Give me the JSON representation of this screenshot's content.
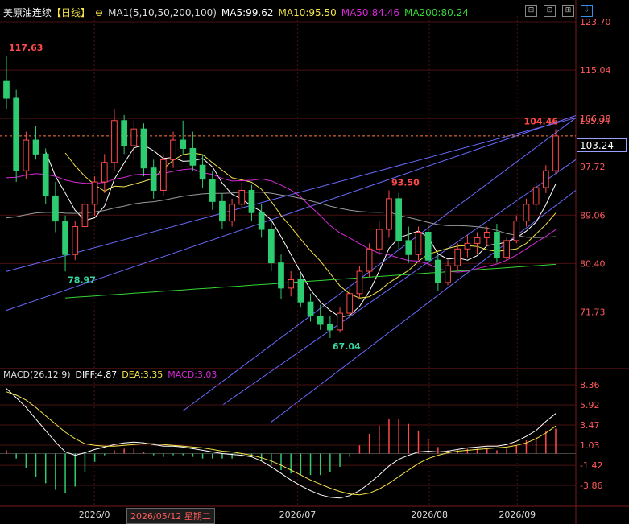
{
  "header": {
    "name": "美原油连续",
    "period": "【日线】",
    "icon": "settings-icon",
    "ma_group_label": "MA1(5,10,50,200,100)",
    "ma5": "MA5:99.62",
    "ma10": "MA10:95.50",
    "ma50": "MA50:84.46",
    "ma200": "MA200:80.24"
  },
  "macd_header": {
    "label": "MACD(26,12,9)",
    "diff": "DIFF:4.87",
    "dea": "DEA:3.35",
    "macd": "MACD:3.03"
  },
  "toolbar": {
    "buttons": [
      "⊟",
      "⊡",
      "⊞",
      "⇩"
    ]
  },
  "current_price": "103.24",
  "date_tip": "2026/05/12 星期二",
  "colors": {
    "up": "#ff4a4a",
    "down": "#2ecc71",
    "ma5": "#ffffff",
    "ma10": "#f5e44a",
    "ma50": "#d62ad6",
    "ma200": "#36d636",
    "ma100": "#9b9b9b",
    "trendline": "#6a6aff",
    "grid": "#4a1010",
    "dif": "#ffffff",
    "dea": "#f5e44a"
  },
  "chart_data": [
    {
      "type": "candlestick",
      "title": "美原油连续",
      "x_ticks": [
        "2026/0",
        "2026/07",
        "2026/08",
        "2026/09"
      ],
      "y_ticks": [
        "123.70",
        "115.04",
        "106.38",
        "97.72",
        "89.06",
        "80.40",
        "71.73"
      ],
      "ylim": [
        67.04,
        123.7
      ],
      "annotations": [
        {
          "label": "117.63",
          "value": 117.63,
          "kind": "high"
        },
        {
          "label": "78.97",
          "value": 78.97,
          "kind": "low"
        },
        {
          "label": "93.50",
          "value": 93.5,
          "kind": "high"
        },
        {
          "label": "67.04",
          "value": 67.04,
          "kind": "low"
        },
        {
          "label": "104.46",
          "value": 104.46,
          "kind": "high"
        }
      ],
      "price_line": 103.24,
      "right_labels": [
        "105.94"
      ],
      "series": [
        {
          "name": "MA5",
          "value": 99.62
        },
        {
          "name": "MA10",
          "value": 95.5
        },
        {
          "name": "MA50",
          "value": 84.46
        },
        {
          "name": "MA200",
          "value": 80.24
        }
      ],
      "candles": [
        {
          "o": 113.0,
          "h": 117.63,
          "l": 108.0,
          "c": 110.0
        },
        {
          "o": 110.0,
          "h": 111.5,
          "l": 95.0,
          "c": 97.0
        },
        {
          "o": 97.0,
          "h": 104.0,
          "l": 95.5,
          "c": 102.5
        },
        {
          "o": 102.5,
          "h": 105.0,
          "l": 99.0,
          "c": 100.0
        },
        {
          "o": 100.0,
          "h": 101.0,
          "l": 91.0,
          "c": 92.5
        },
        {
          "o": 92.5,
          "h": 95.0,
          "l": 86.0,
          "c": 88.0
        },
        {
          "o": 88.0,
          "h": 89.0,
          "l": 78.97,
          "c": 82.0
        },
        {
          "o": 82.0,
          "h": 88.0,
          "l": 81.0,
          "c": 87.0
        },
        {
          "o": 87.0,
          "h": 92.0,
          "l": 86.0,
          "c": 91.0
        },
        {
          "o": 91.0,
          "h": 96.0,
          "l": 89.0,
          "c": 95.0
        },
        {
          "o": 95.0,
          "h": 100.0,
          "l": 93.0,
          "c": 98.5
        },
        {
          "o": 98.5,
          "h": 108.0,
          "l": 97.0,
          "c": 106.0
        },
        {
          "o": 106.0,
          "h": 107.0,
          "l": 100.0,
          "c": 101.5
        },
        {
          "o": 101.5,
          "h": 106.0,
          "l": 99.0,
          "c": 104.5
        },
        {
          "o": 104.5,
          "h": 105.5,
          "l": 96.0,
          "c": 97.5
        },
        {
          "o": 97.5,
          "h": 99.0,
          "l": 92.0,
          "c": 93.5
        },
        {
          "o": 93.5,
          "h": 100.0,
          "l": 92.5,
          "c": 99.0
        },
        {
          "o": 99.0,
          "h": 104.0,
          "l": 97.5,
          "c": 102.5
        },
        {
          "o": 102.5,
          "h": 106.0,
          "l": 100.0,
          "c": 101.0
        },
        {
          "o": 101.0,
          "h": 104.0,
          "l": 97.0,
          "c": 98.0
        },
        {
          "o": 98.0,
          "h": 100.0,
          "l": 94.0,
          "c": 95.5
        },
        {
          "o": 95.5,
          "h": 97.0,
          "l": 90.0,
          "c": 91.5
        },
        {
          "o": 91.5,
          "h": 93.0,
          "l": 86.5,
          "c": 88.0
        },
        {
          "o": 88.0,
          "h": 92.0,
          "l": 87.0,
          "c": 91.0
        },
        {
          "o": 91.0,
          "h": 95.0,
          "l": 90.0,
          "c": 93.5
        },
        {
          "o": 93.5,
          "h": 94.5,
          "l": 88.0,
          "c": 89.5
        },
        {
          "o": 89.5,
          "h": 91.0,
          "l": 85.0,
          "c": 86.5
        },
        {
          "o": 86.5,
          "h": 88.0,
          "l": 79.0,
          "c": 80.5
        },
        {
          "o": 80.5,
          "h": 82.0,
          "l": 74.0,
          "c": 76.0
        },
        {
          "o": 76.0,
          "h": 79.0,
          "l": 74.5,
          "c": 77.5
        },
        {
          "o": 77.5,
          "h": 78.5,
          "l": 72.5,
          "c": 73.5
        },
        {
          "o": 73.5,
          "h": 75.0,
          "l": 70.0,
          "c": 71.0
        },
        {
          "o": 71.0,
          "h": 73.0,
          "l": 68.5,
          "c": 69.5
        },
        {
          "o": 69.5,
          "h": 71.0,
          "l": 67.04,
          "c": 68.5
        },
        {
          "o": 68.5,
          "h": 72.5,
          "l": 68.0,
          "c": 71.5
        },
        {
          "o": 71.5,
          "h": 76.0,
          "l": 71.0,
          "c": 75.0
        },
        {
          "o": 75.0,
          "h": 80.0,
          "l": 74.0,
          "c": 79.0
        },
        {
          "o": 79.0,
          "h": 84.0,
          "l": 78.0,
          "c": 83.0
        },
        {
          "o": 83.0,
          "h": 88.0,
          "l": 82.0,
          "c": 86.5
        },
        {
          "o": 86.5,
          "h": 93.5,
          "l": 85.0,
          "c": 92.0
        },
        {
          "o": 92.0,
          "h": 93.0,
          "l": 83.0,
          "c": 84.5
        },
        {
          "o": 84.5,
          "h": 87.0,
          "l": 80.5,
          "c": 82.0
        },
        {
          "o": 82.0,
          "h": 87.0,
          "l": 81.0,
          "c": 86.0
        },
        {
          "o": 86.0,
          "h": 87.5,
          "l": 80.0,
          "c": 81.0
        },
        {
          "o": 81.0,
          "h": 82.0,
          "l": 75.5,
          "c": 77.0
        },
        {
          "o": 77.0,
          "h": 81.0,
          "l": 76.5,
          "c": 80.0
        },
        {
          "o": 80.0,
          "h": 84.0,
          "l": 79.0,
          "c": 83.0
        },
        {
          "o": 83.0,
          "h": 85.5,
          "l": 81.5,
          "c": 84.0
        },
        {
          "o": 84.0,
          "h": 86.0,
          "l": 82.0,
          "c": 85.0
        },
        {
          "o": 85.0,
          "h": 87.0,
          "l": 83.5,
          "c": 86.0
        },
        {
          "o": 86.0,
          "h": 87.5,
          "l": 80.5,
          "c": 81.5
        },
        {
          "o": 81.5,
          "h": 85.0,
          "l": 81.0,
          "c": 84.5
        },
        {
          "o": 84.5,
          "h": 89.0,
          "l": 84.0,
          "c": 88.0
        },
        {
          "o": 88.0,
          "h": 92.0,
          "l": 87.0,
          "c": 91.0
        },
        {
          "o": 91.0,
          "h": 95.0,
          "l": 90.0,
          "c": 94.0
        },
        {
          "o": 94.0,
          "h": 98.0,
          "l": 93.0,
          "c": 97.0
        },
        {
          "o": 97.0,
          "h": 104.46,
          "l": 96.5,
          "c": 103.24
        }
      ]
    },
    {
      "type": "bar",
      "title": "MACD(26,12,9)",
      "y_ticks": [
        "8.36",
        "5.92",
        "3.47",
        "1.03",
        "-1.42",
        "-3.86"
      ],
      "ylim": [
        -6.3,
        8.36
      ],
      "series": [
        {
          "name": "DIFF",
          "value": 4.87
        },
        {
          "name": "DEA",
          "value": 3.35
        },
        {
          "name": "MACD",
          "value": 3.03
        }
      ],
      "dif": [
        7.9,
        6.8,
        5.6,
        4.2,
        2.8,
        1.4,
        0.2,
        -0.2,
        0.1,
        0.5,
        0.8,
        1.1,
        1.3,
        1.4,
        1.3,
        1.1,
        0.9,
        0.9,
        0.8,
        0.6,
        0.4,
        0.2,
        0.0,
        -0.1,
        -0.2,
        -0.4,
        -0.9,
        -1.6,
        -2.4,
        -3.2,
        -3.9,
        -4.5,
        -5.0,
        -5.3,
        -5.4,
        -5.1,
        -4.5,
        -3.6,
        -2.6,
        -1.5,
        -0.7,
        -0.2,
        0.2,
        0.3,
        0.2,
        0.3,
        0.5,
        0.7,
        0.8,
        0.9,
        0.9,
        1.1,
        1.5,
        2.1,
        2.8,
        3.9,
        4.87
      ],
      "dea": [
        7.5,
        7.1,
        6.5,
        5.6,
        4.6,
        3.6,
        2.6,
        1.8,
        1.2,
        1.0,
        0.9,
        0.9,
        1.0,
        1.1,
        1.2,
        1.2,
        1.1,
        1.0,
        0.9,
        0.8,
        0.7,
        0.5,
        0.3,
        0.2,
        0.0,
        -0.2,
        -0.5,
        -0.9,
        -1.4,
        -2.0,
        -2.6,
        -3.2,
        -3.7,
        -4.2,
        -4.6,
        -4.9,
        -5.0,
        -4.8,
        -4.3,
        -3.6,
        -2.8,
        -2.0,
        -1.2,
        -0.6,
        -0.2,
        0.1,
        0.3,
        0.4,
        0.5,
        0.6,
        0.7,
        0.8,
        1.0,
        1.3,
        1.8,
        2.5,
        3.35
      ],
      "macd": [
        0.4,
        -0.6,
        -1.8,
        -2.8,
        -3.6,
        -4.4,
        -4.8,
        -4.0,
        -2.2,
        -1.0,
        -0.2,
        0.4,
        0.6,
        0.6,
        0.2,
        -0.2,
        -0.4,
        -0.2,
        -0.2,
        -0.4,
        -0.6,
        -0.6,
        -0.6,
        -0.6,
        -0.4,
        -0.4,
        -0.8,
        -1.4,
        -2.0,
        -2.4,
        -2.6,
        -2.6,
        -2.6,
        -2.2,
        -1.6,
        -0.4,
        1.0,
        2.4,
        3.4,
        4.2,
        4.2,
        3.6,
        2.8,
        1.8,
        0.8,
        0.4,
        0.4,
        0.6,
        0.6,
        0.6,
        0.4,
        0.6,
        1.0,
        1.6,
        2.0,
        2.8,
        3.03
      ]
    }
  ]
}
